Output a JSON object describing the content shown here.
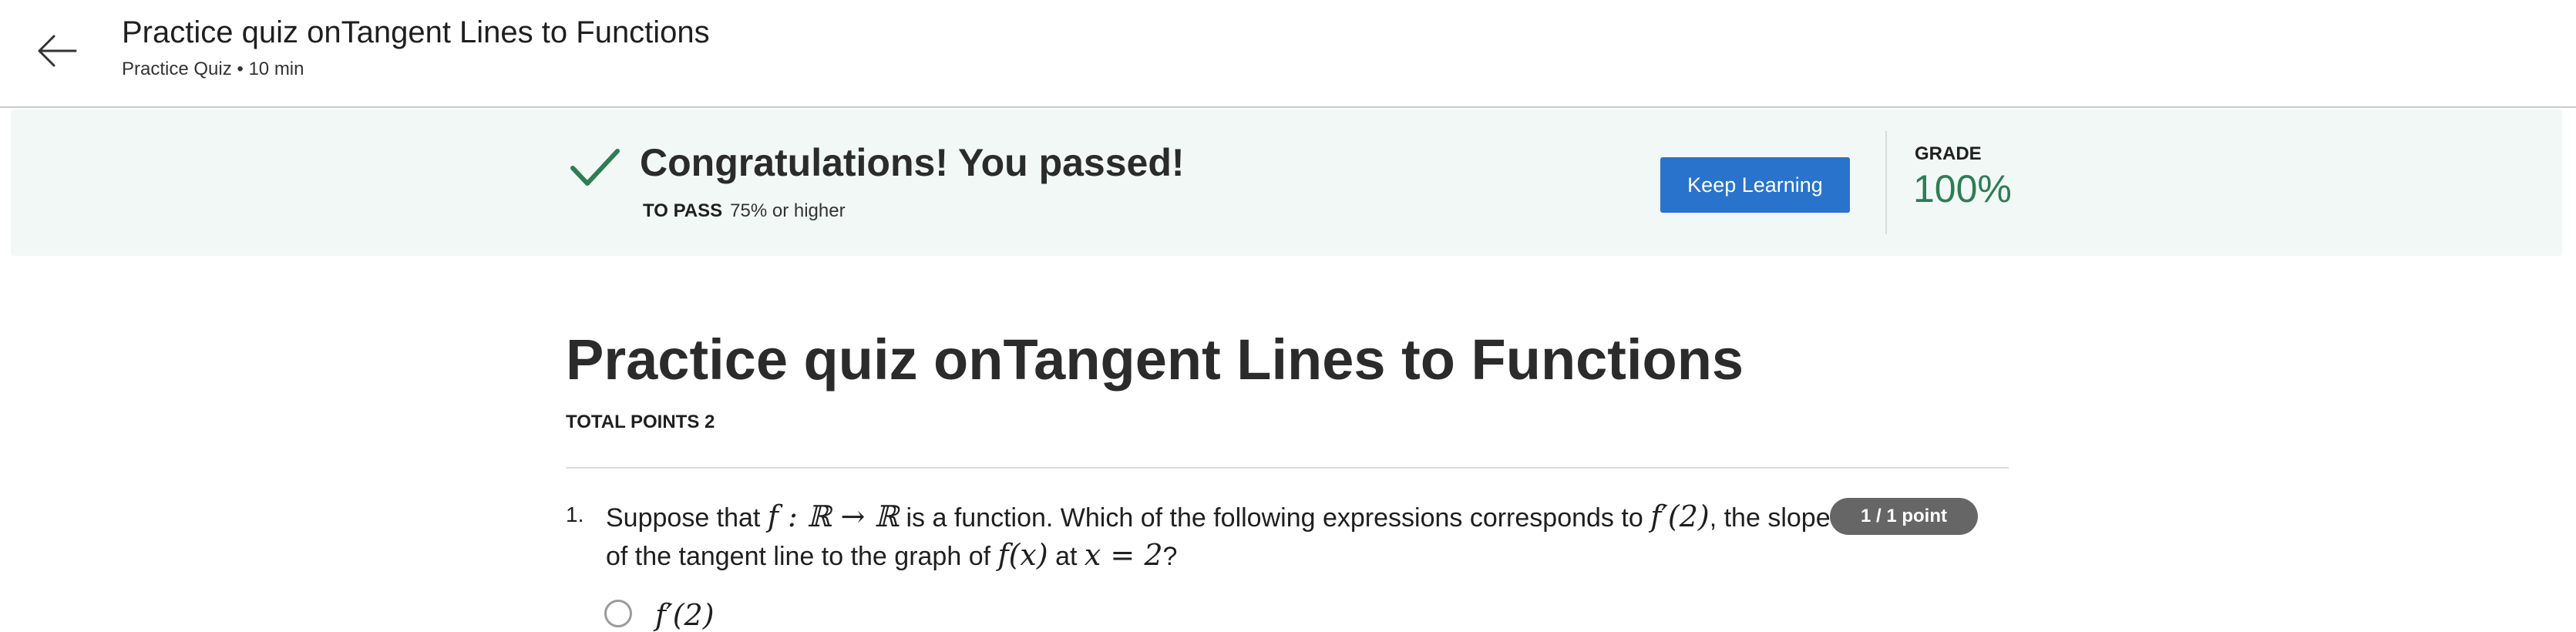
{
  "header": {
    "title": "Practice quiz onTangent Lines to Functions",
    "subtitle": "Practice Quiz • 10 min",
    "back_icon": "arrow-left-icon"
  },
  "banner": {
    "message": "Congratulations! You passed!",
    "to_pass_label": "TO PASS",
    "to_pass_value": "75% or higher",
    "button_label": "Keep Learning",
    "grade_label": "GRADE",
    "grade_value": "100%",
    "check_icon": "check-icon",
    "colors": {
      "background": "#f2f8f6",
      "check": "#2e7d55",
      "button": "#2a73cc",
      "grade": "#2e7d55"
    }
  },
  "main": {
    "title": "Practice quiz onTangent Lines to Functions",
    "total_points": "TOTAL POINTS 2"
  },
  "question": {
    "number": "1.",
    "text_a": "Suppose that ",
    "math_a": "f : ℝ → ℝ",
    "text_b": " is a function. Which of the following expressions corresponds to ",
    "math_b": "f′(2)",
    "text_c": ", the slope",
    "text_d": "of the tangent line to the graph of ",
    "math_c": "f(x)",
    "text_e": " at ",
    "math_d": "x = 2",
    "text_f": "?",
    "points": "1 / 1 point",
    "first_choice_partial": "f′(2)"
  }
}
